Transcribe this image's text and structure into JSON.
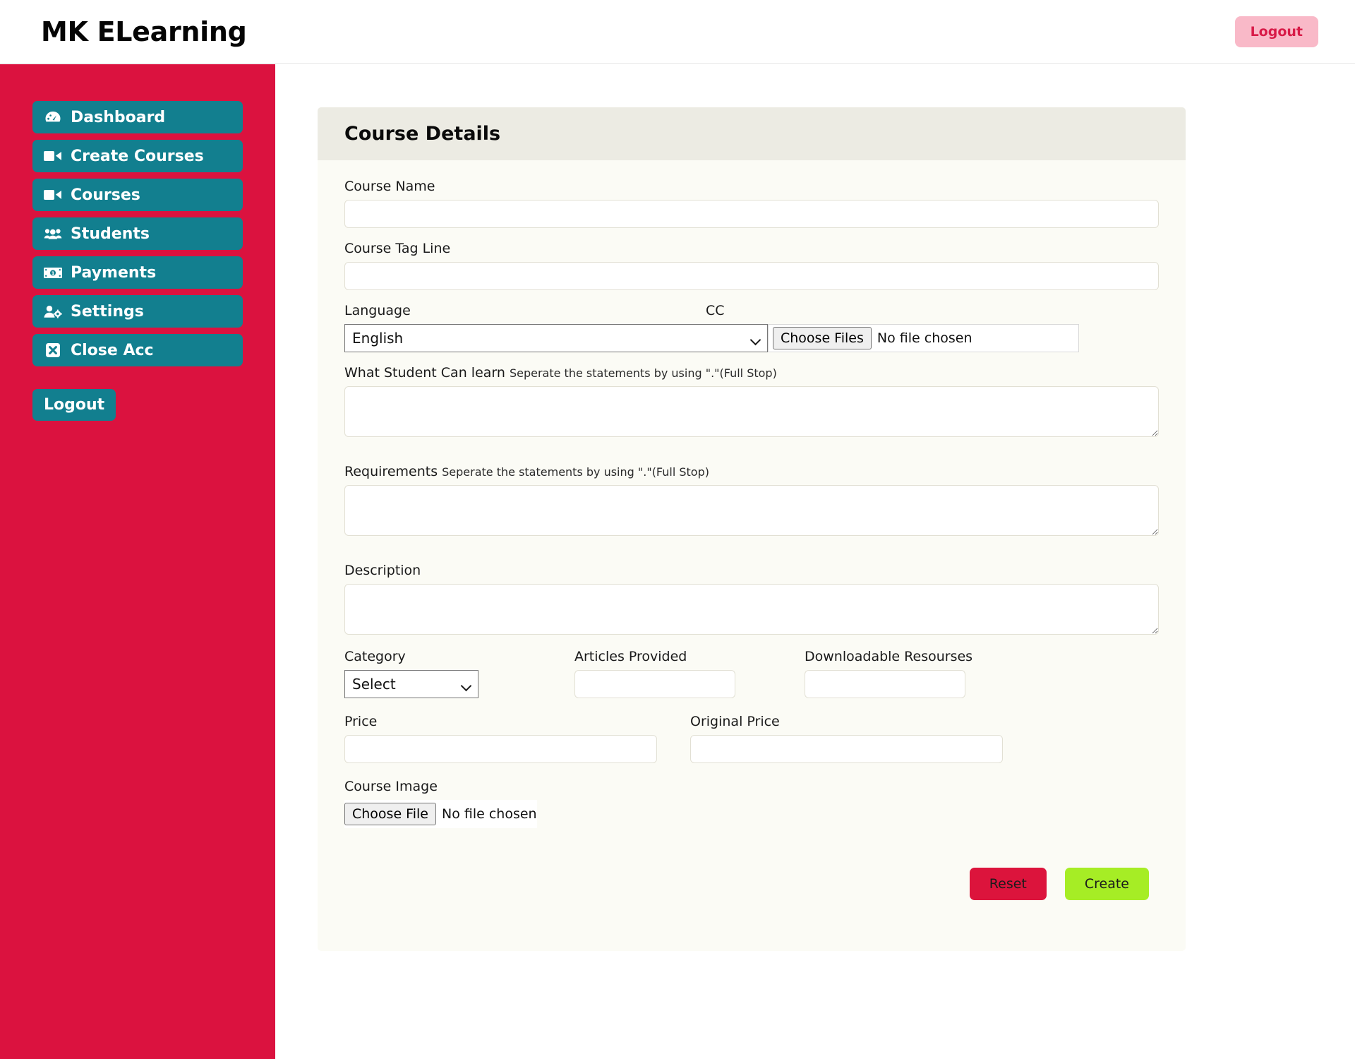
{
  "header": {
    "brand": "MK ELearning",
    "logout_label": "Logout"
  },
  "sidebar": {
    "items": [
      {
        "label": "Dashboard",
        "icon": "dashboard-icon"
      },
      {
        "label": "Create Courses",
        "icon": "video-icon"
      },
      {
        "label": "Courses",
        "icon": "video-icon"
      },
      {
        "label": "Students",
        "icon": "users-icon"
      },
      {
        "label": "Payments",
        "icon": "money-bill-icon"
      },
      {
        "label": "Settings",
        "icon": "user-gear-icon"
      },
      {
        "label": "Close Acc",
        "icon": "close-square-icon"
      }
    ],
    "logout_label": "Logout"
  },
  "card": {
    "title": "Course Details",
    "fields": {
      "course_name": {
        "label": "Course Name",
        "value": "",
        "placeholder": ""
      },
      "course_tag_line": {
        "label": "Course Tag Line",
        "value": "",
        "placeholder": ""
      },
      "language": {
        "label": "Language",
        "value": "English",
        "options": [
          "English"
        ]
      },
      "cc": {
        "label": "CC",
        "button": "Choose Files",
        "status": "No file chosen"
      },
      "what_student_can_learn": {
        "label": "What Student Can learn",
        "hint": "Seperate the statements by using \".\"(Full Stop)",
        "value": ""
      },
      "requirements": {
        "label": "Requirements",
        "hint": "Seperate the statements by using \".\"(Full Stop)",
        "value": ""
      },
      "description": {
        "label": "Description",
        "value": ""
      },
      "category": {
        "label": "Category",
        "value": "Select",
        "options": [
          "Select"
        ]
      },
      "articles_provided": {
        "label": "Articles Provided",
        "value": ""
      },
      "downloadable_resources": {
        "label": "Downloadable Resourses",
        "value": ""
      },
      "price": {
        "label": "Price",
        "value": ""
      },
      "original_price": {
        "label": "Original Price",
        "value": ""
      },
      "course_image": {
        "label": "Course Image",
        "button": "Choose File",
        "status": "No file chosen"
      }
    },
    "actions": {
      "reset_label": "Reset",
      "create_label": "Create"
    }
  },
  "colors": {
    "sidebar_bg": "#db123f",
    "nav_item_bg": "#127f8f",
    "card_header_bg": "#ecebe3",
    "card_body_bg": "#fbfbf5",
    "reset_bg": "#dc143c",
    "create_bg": "#a6ed25",
    "top_logout_bg": "#f9b9c8",
    "top_logout_fg": "#d81b48"
  }
}
